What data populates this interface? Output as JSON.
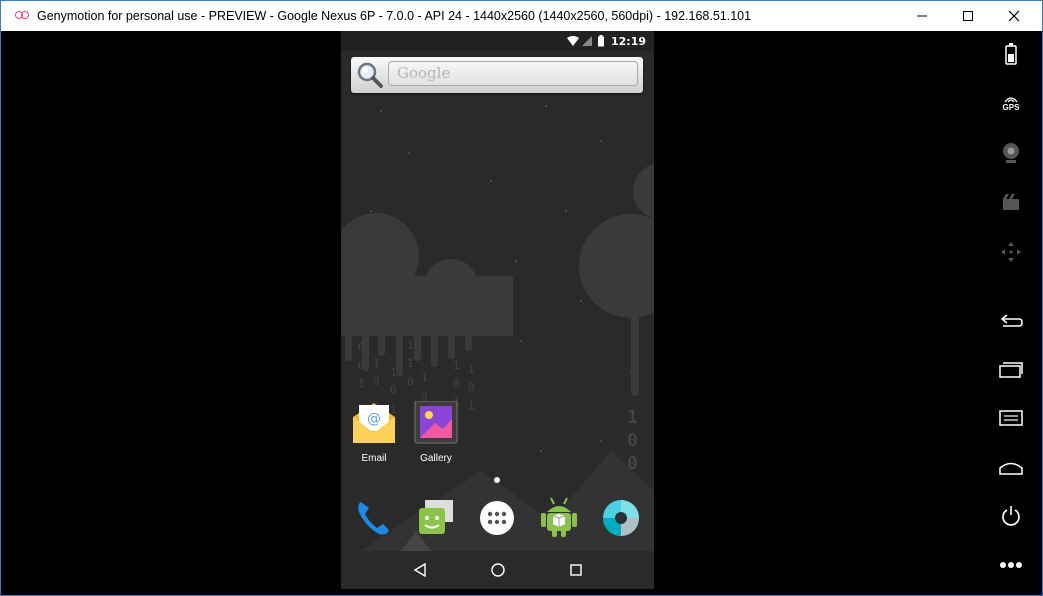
{
  "window": {
    "title": "Genymotion for personal use - PREVIEW - Google Nexus 6P - 7.0.0 - API 24 - 1440x2560 (1440x2560, 560dpi) - 192.168.51.101"
  },
  "statusbar": {
    "time": "12:19"
  },
  "search_widget": {
    "placeholder": "Google"
  },
  "apps": [
    {
      "label": "Email",
      "icon": "email-icon"
    },
    {
      "label": "Gallery",
      "icon": "gallery-icon"
    }
  ],
  "dock": [
    "phone-icon",
    "messaging-icon",
    "app-drawer-icon",
    "android-market-icon",
    "camera-icon"
  ],
  "navbar": [
    "back-icon",
    "home-icon",
    "recents-icon"
  ],
  "toolbar": {
    "gps_label": "GPS",
    "tools": [
      "battery-icon",
      "gps-icon",
      "webcam-icon",
      "capture-icon",
      "dpad-icon",
      "back-icon",
      "recent-apps-icon",
      "menu-icon",
      "home-icon",
      "power-icon",
      "more-icon"
    ]
  },
  "colors": {
    "window_border": "#3c78c8",
    "accent_icon": "#e0457b",
    "dock_phone": "#1e88e5"
  }
}
